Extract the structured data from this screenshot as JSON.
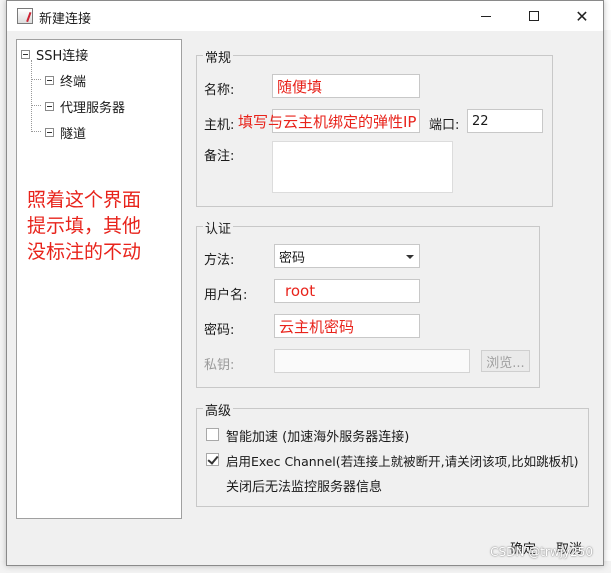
{
  "window": {
    "title": "新建连接"
  },
  "tree": {
    "root": "SSH连接",
    "children": [
      "终端",
      "代理服务器",
      "隧道"
    ]
  },
  "annotation": {
    "lines": [
      "照着这个界面",
      "提示填，其他",
      "没标注的不动"
    ]
  },
  "general": {
    "title": "常规",
    "name_label": "名称:",
    "name_value": "随便填",
    "host_label": "主机:",
    "host_value": "填写与云主机绑定的弹性IP",
    "port_label": "端口:",
    "port_value": "22",
    "remark_label": "备注:"
  },
  "auth": {
    "title": "认证",
    "method_label": "方法:",
    "method_value": "密码",
    "username_label": "用户名:",
    "username_value": "root",
    "password_label": "密码:",
    "password_value": "云主机密码",
    "key_label": "私钥:",
    "browse_label": "浏览..."
  },
  "advanced": {
    "title": "高级",
    "smart_accel_label": "智能加速 (加速海外服务器连接)",
    "smart_accel_checked": false,
    "exec_channel_label": "启用Exec Channel(若连接上就被断开,请关闭该项,比如跳板机)",
    "exec_channel_checked": true,
    "note": "关闭后无法监控服务器信息"
  },
  "footer": {
    "ok_label": "确定",
    "cancel_label": "取消"
  },
  "watermark": "CSDN @trwjy250"
}
